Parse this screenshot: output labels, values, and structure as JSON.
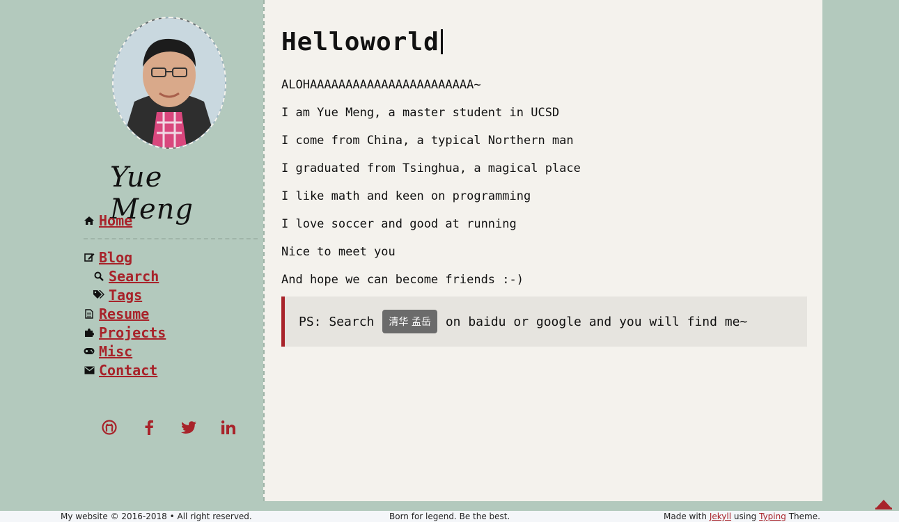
{
  "sidebar": {
    "name": "Yue Meng",
    "nav": {
      "home": "Home",
      "blog": "Blog",
      "search": "Search",
      "tags": "Tags",
      "resume": "Resume",
      "projects": "Projects",
      "misc": "Misc",
      "contact": "Contact"
    },
    "social_icons": [
      "github-icon",
      "facebook-icon",
      "twitter-icon",
      "linkedin-icon"
    ]
  },
  "main": {
    "title": "Helloworld",
    "paragraphs": [
      "ALOHAAAAAAAAAAAAAAAAAAAAAAA~",
      "I am Yue Meng, a master student in UCSD",
      "I come from China, a typical Northern man",
      "I graduated from Tsinghua, a magical place",
      "I like math and keen on programming",
      "I love soccer and good at running",
      "Nice to meet you",
      "And hope we can become friends :-)"
    ],
    "quote": {
      "prefix": "PS: Search",
      "code": "清华 孟岳",
      "suffix": "on baidu or google and you will find me~"
    }
  },
  "footer": {
    "left": "My website © 2016-2018 • All right reserved.",
    "center": "Born for legend. Be the best.",
    "made_with": "Made with",
    "jekyll": "Jekyll",
    "using": "using",
    "typing": "Typing",
    "theme": "Theme."
  },
  "colors": {
    "background": "#b3c9bd",
    "content": "#f4f2ed",
    "accent": "#a8232a"
  }
}
